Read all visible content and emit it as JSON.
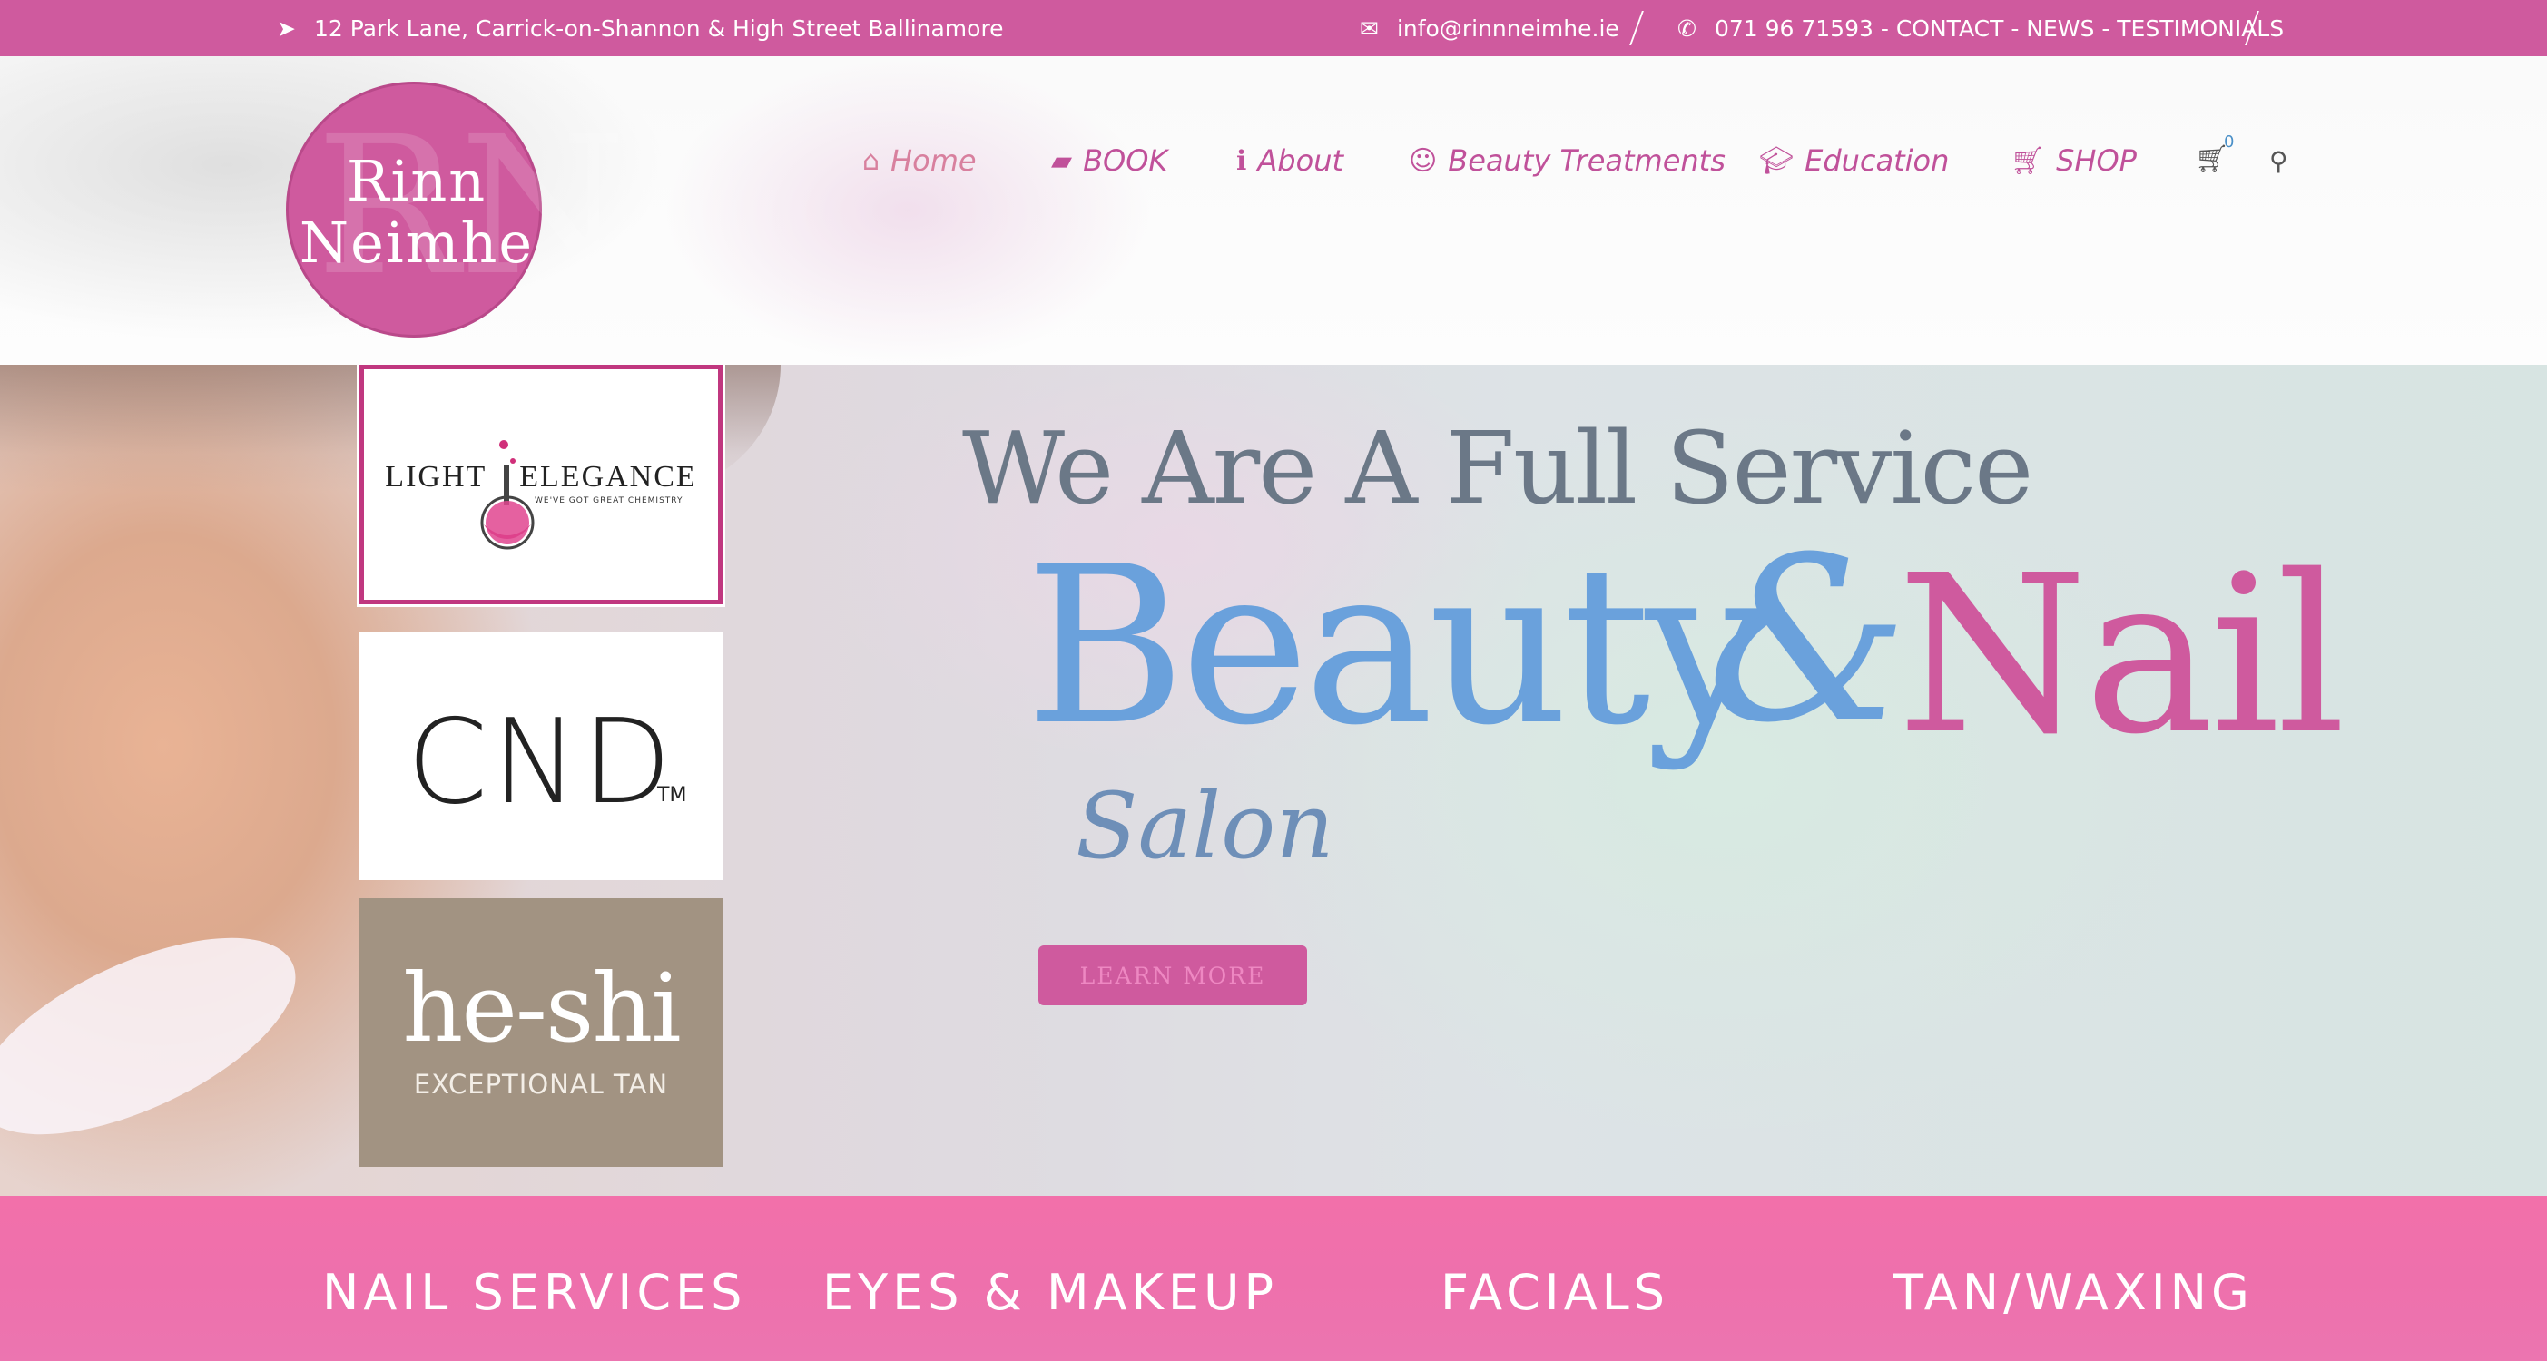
{
  "topbar": {
    "address": "12 Park Lane, Carrick-on-Shannon & High Street Ballinamore",
    "email": "info@rinnneimhe.ie",
    "phone_links": "071 96 71593 - CONTACT - NEWS - TESTIMONIALS"
  },
  "logo": {
    "line1": "Rinn",
    "line2": "Neimhe",
    "monogram": "RN"
  },
  "nav": {
    "items": [
      {
        "label": "Home",
        "icon": "home-icon",
        "color": "#d8809e"
      },
      {
        "label": "BOOK",
        "icon": "book-icon"
      },
      {
        "label": "About",
        "icon": "info-icon"
      },
      {
        "label": "Beauty Treatments",
        "icon": "smile-icon"
      },
      {
        "label": "Education",
        "icon": "graduation-cap-icon"
      },
      {
        "label": "SHOP",
        "icon": "cart-icon"
      }
    ],
    "cart_count": "0"
  },
  "brands": {
    "light_elegance": {
      "name_left": "LIGHT",
      "name_right": "ELEGANCE",
      "tagline": "WE'VE GOT GREAT CHEMISTRY"
    },
    "cnd": {
      "name": "CND",
      "tm": "TM"
    },
    "heshi": {
      "name": "he-shi",
      "tagline": "EXCEPTIONAL TAN"
    }
  },
  "hero": {
    "line1": "We Are A Full Service",
    "beauty": "Beauty",
    "amp": "&",
    "nail": "Nail",
    "salon": "Salon",
    "button": "LEARN MORE"
  },
  "services": {
    "items": [
      "NAIL SERVICES",
      "EYES & MAKEUP",
      "FACIALS",
      "TAN/WAXING"
    ]
  },
  "colors": {
    "brand_pink": "#cf5a9e",
    "blue": "#6aa1dc",
    "services_pink": "#f270aa"
  }
}
